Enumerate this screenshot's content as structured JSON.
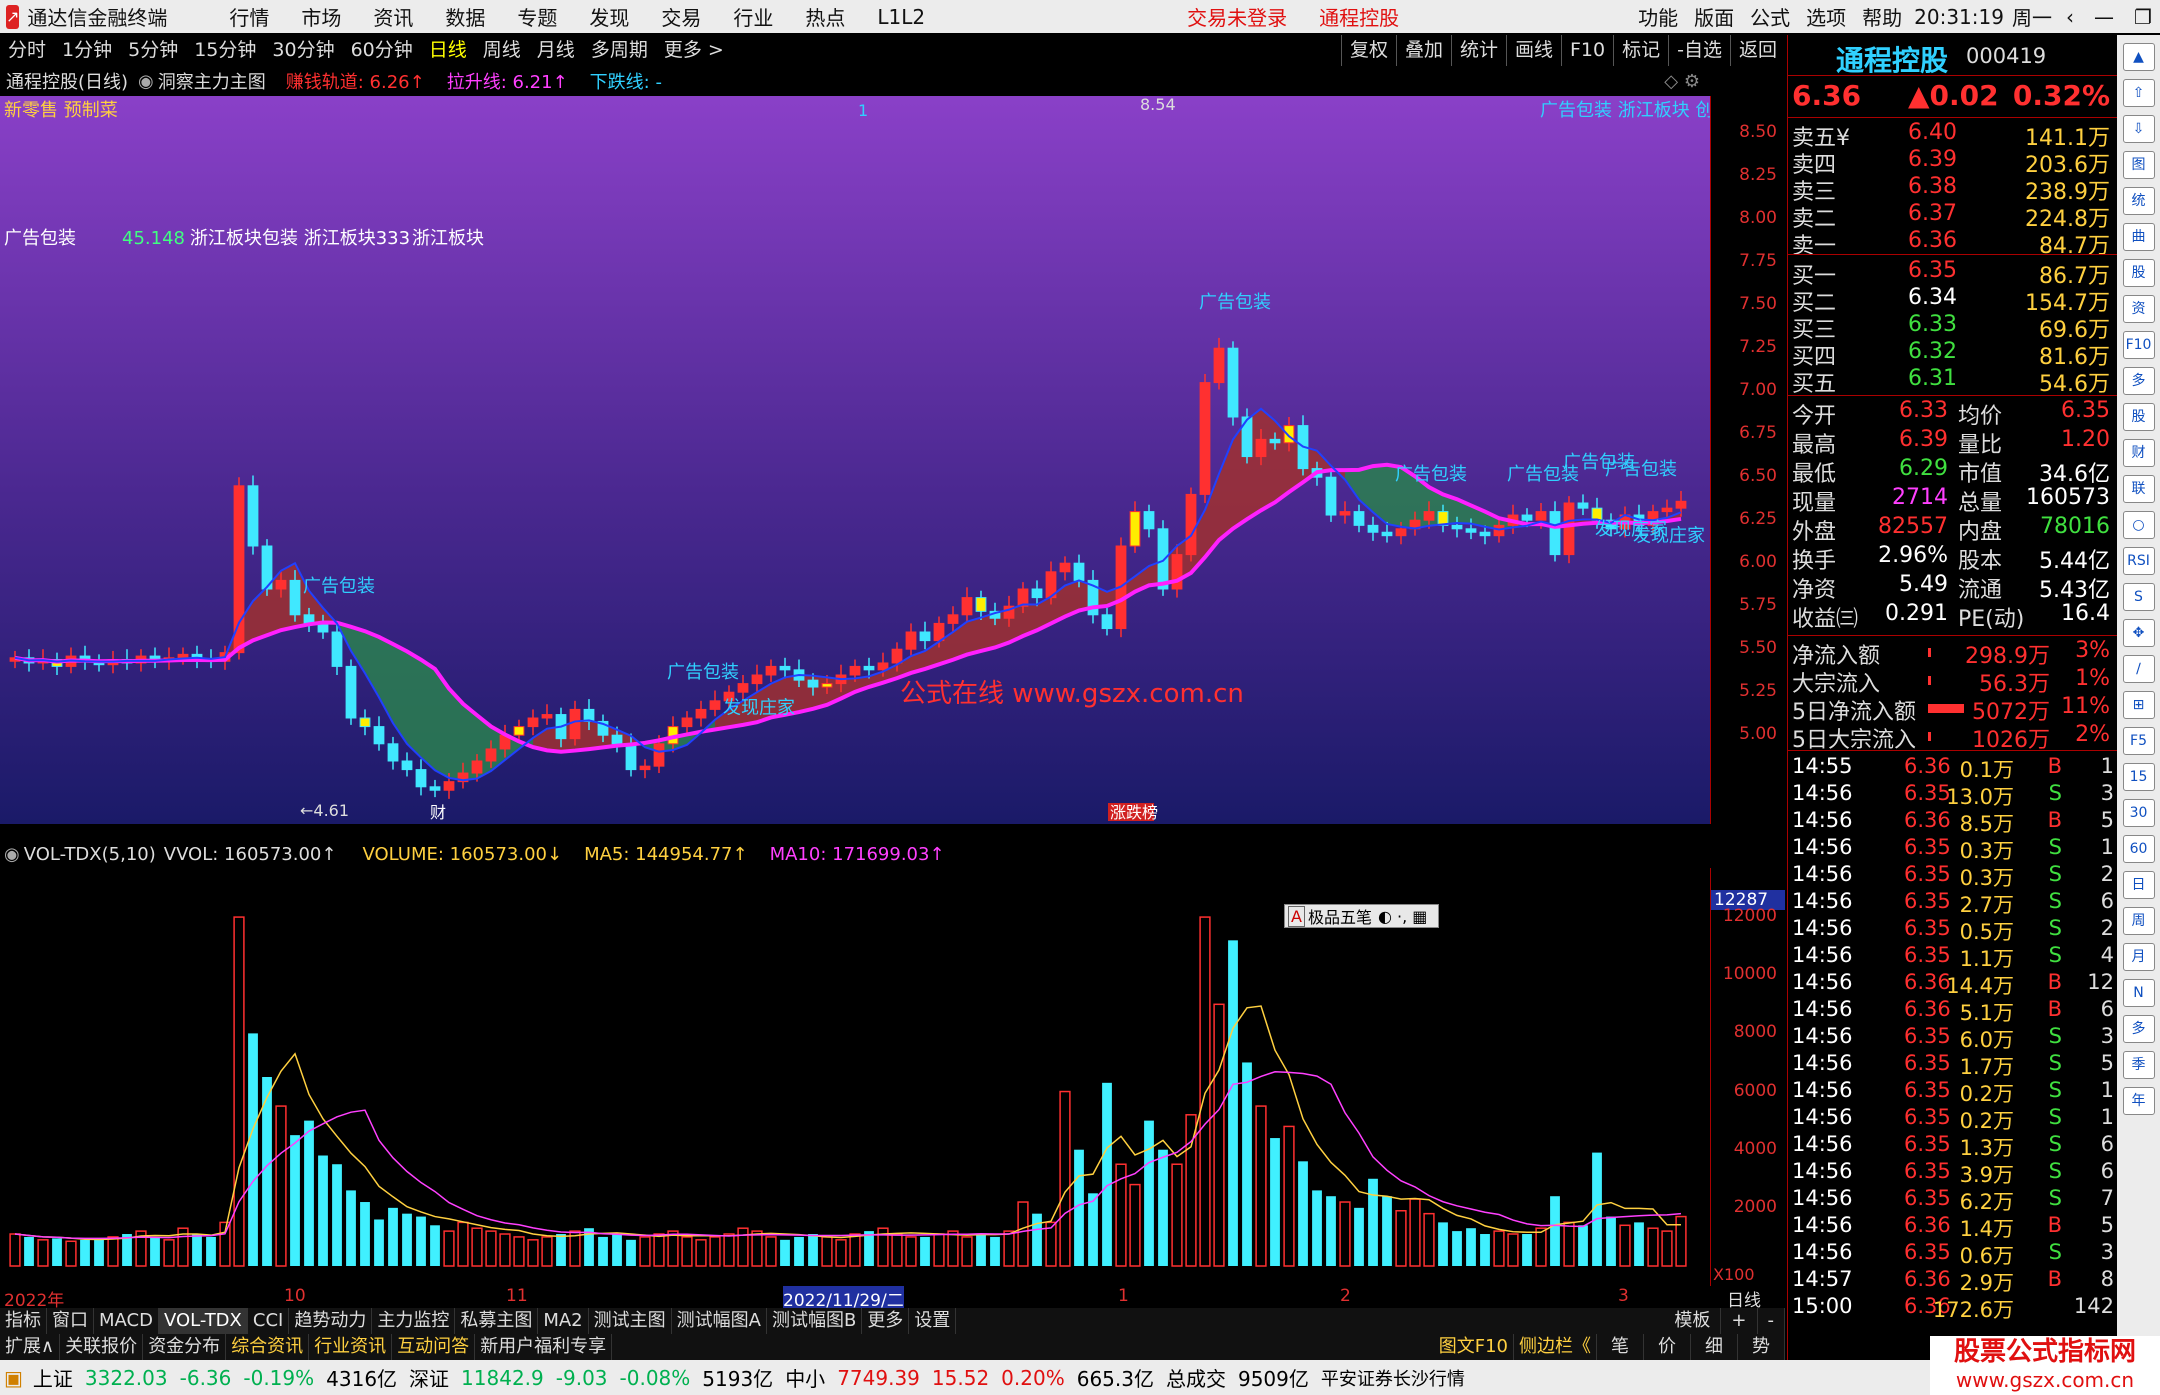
{
  "menu": {
    "app_title": "通达信金融终端",
    "items": [
      "行情",
      "市场",
      "资讯",
      "数据",
      "专题",
      "发现",
      "交易",
      "行业",
      "热点",
      "L1L2"
    ],
    "login": "交易未登录",
    "stock_name_red": "通程控股",
    "right_items": [
      "功能",
      "版面",
      "公式",
      "选项",
      "帮助"
    ],
    "clock": "20:31:19",
    "weekday": "周一"
  },
  "toolbar": {
    "periods": [
      "分时",
      "1分钟",
      "5分钟",
      "15分钟",
      "30分钟",
      "60分钟",
      "日线",
      "周线",
      "月线",
      "多周期",
      "更多 >"
    ],
    "active": "日线",
    "right": [
      "复权",
      "叠加",
      "统计",
      "画线",
      "F10",
      "标记",
      "-自选",
      "返回"
    ]
  },
  "infobar": {
    "title": "通程控股(日线)",
    "indicator": "洞察主力主图",
    "l1": "赚钱轨道: 6.26↑",
    "l2": "拉升线: 6.21↑",
    "l3": "下跌线: -"
  },
  "chart_overlay": {
    "top_left": "新零售 预制菜",
    "top_mid": "1",
    "top_right": "广告包装 浙江板块 创",
    "row2_a": "广告包装",
    "row2_b": "45.148",
    "row2_c": "浙江板块包装 浙江板块333",
    "row2_d": "浙江板块",
    "high_label": "8.54",
    "low_label": "←4.61",
    "watermark": "公式在线  www.gszx.com.cn",
    "sig_labels": [
      "广告包装",
      "广告包装",
      "广告包装",
      "广告包装",
      "广告包装",
      "广告包装",
      "广告包装"
    ],
    "find_labels": [
      "发现庄家",
      "发现庄家",
      "发现庄家"
    ],
    "cai": "财",
    "zdb": "涨跌榜"
  },
  "price_axis": [
    "8.50",
    "8.25",
    "8.00",
    "7.75",
    "7.50",
    "7.25",
    "7.00",
    "6.75",
    "6.50",
    "6.25",
    "6.00",
    "5.75",
    "5.50",
    "5.25",
    "5.00"
  ],
  "volbar": {
    "name": "VOL-TDX(5,10)",
    "vvol": "VVOL: 160573.00↑",
    "volume": "VOLUME: 160573.00↓",
    "ma5": "MA5: 144954.77↑",
    "ma10": "MA10: 171699.03↑"
  },
  "vol_axis": [
    "12000",
    "10000",
    "8000",
    "6000",
    "4000",
    "2000"
  ],
  "vol_axis_highlight": "12287",
  "vol_unit": "X100",
  "popup": "极品五笔",
  "dates": [
    "2022年",
    "10",
    "11",
    "2022/11/29/二",
    "1",
    "2",
    "3"
  ],
  "date_axis_right": "日线",
  "tabs1": [
    "指标",
    "窗口",
    "MACD",
    "VOL-TDX",
    "CCI",
    "趋势动力",
    "主力监控",
    "私募主图",
    "MA2",
    "测试主图",
    "测试幅图A",
    "测试幅图B",
    "更多",
    "设置"
  ],
  "tabs1_right": [
    "模板",
    "+",
    "-"
  ],
  "tabs2": [
    "扩展∧",
    "关联报价",
    "资金分布",
    "综合资讯",
    "行业资讯",
    "互动问答",
    "新用户福利专享"
  ],
  "tabs2_right": [
    "图文F10",
    "侧边栏《",
    "笔",
    "价",
    "细",
    "势"
  ],
  "quote": {
    "name": "通程控股",
    "code": "000419",
    "price": "6.36",
    "change": "▲0.02",
    "pct": "0.32%",
    "asks": [
      [
        "卖五¥",
        "6.40",
        "141.1万"
      ],
      [
        "卖四",
        "6.39",
        "203.6万"
      ],
      [
        "卖三",
        "6.38",
        "238.9万"
      ],
      [
        "卖二",
        "6.37",
        "224.8万"
      ],
      [
        "卖一",
        "6.36",
        "84.7万"
      ]
    ],
    "bids": [
      [
        "买一",
        "6.35",
        "86.7万"
      ],
      [
        "买二",
        "6.34",
        "154.7万"
      ],
      [
        "买三",
        "6.33",
        "69.6万"
      ],
      [
        "买四",
        "6.32",
        "81.6万"
      ],
      [
        "买五",
        "6.31",
        "54.6万"
      ]
    ],
    "stats": [
      [
        "今开",
        "6.33",
        "均价",
        "6.35"
      ],
      [
        "最高",
        "6.39",
        "量比",
        "1.20"
      ],
      [
        "最低",
        "6.29",
        "市值",
        "34.6亿"
      ],
      [
        "现量",
        "2714",
        "总量",
        "160573"
      ],
      [
        "外盘",
        "82557",
        "内盘",
        "78016"
      ],
      [
        "换手",
        "2.96%",
        "股本",
        "5.44亿"
      ],
      [
        "净资",
        "5.49",
        "流通",
        "5.43亿"
      ],
      [
        "收益㈢",
        "0.291",
        "PE(动)",
        "16.4"
      ]
    ],
    "flows": [
      [
        "净流入额",
        "298.9万",
        "3%"
      ],
      [
        "大宗流入",
        "56.3万",
        "1%"
      ],
      [
        "5日净流入额",
        "5072万",
        "11%"
      ],
      [
        "5日大宗流入",
        "1026万",
        "2%"
      ]
    ],
    "ticks": [
      [
        "14:55",
        "6.36",
        "0.1万",
        "B",
        "1"
      ],
      [
        "14:56",
        "6.35",
        "13.0万",
        "S",
        "3"
      ],
      [
        "14:56",
        "6.36",
        "8.5万",
        "B",
        "5"
      ],
      [
        "14:56",
        "6.35",
        "0.3万",
        "S",
        "1"
      ],
      [
        "14:56",
        "6.35",
        "0.3万",
        "S",
        "2"
      ],
      [
        "14:56",
        "6.35",
        "2.7万",
        "S",
        "6"
      ],
      [
        "14:56",
        "6.35",
        "0.5万",
        "S",
        "2"
      ],
      [
        "14:56",
        "6.35",
        "1.1万",
        "S",
        "4"
      ],
      [
        "14:56",
        "6.36",
        "14.4万",
        "B",
        "12"
      ],
      [
        "14:56",
        "6.36",
        "5.1万",
        "B",
        "6"
      ],
      [
        "14:56",
        "6.35",
        "6.0万",
        "S",
        "3"
      ],
      [
        "14:56",
        "6.35",
        "1.7万",
        "S",
        "5"
      ],
      [
        "14:56",
        "6.35",
        "0.2万",
        "S",
        "1"
      ],
      [
        "14:56",
        "6.35",
        "0.2万",
        "S",
        "1"
      ],
      [
        "14:56",
        "6.35",
        "1.3万",
        "S",
        "6"
      ],
      [
        "14:56",
        "6.35",
        "3.9万",
        "S",
        "6"
      ],
      [
        "14:56",
        "6.35",
        "6.2万",
        "S",
        "7"
      ],
      [
        "14:56",
        "6.36",
        "1.4万",
        "B",
        "5"
      ],
      [
        "14:56",
        "6.35",
        "0.6万",
        "S",
        "3"
      ],
      [
        "14:57",
        "6.36",
        "2.9万",
        "B",
        "8"
      ],
      [
        "15:00",
        "6.36",
        "172.6万",
        "",
        "142"
      ]
    ]
  },
  "rail": [
    "▲",
    "⇧",
    "⇩",
    "图",
    "统",
    "曲",
    "股",
    "资",
    "F10",
    "多",
    "股",
    "财",
    "联",
    "○",
    "RSI",
    "S",
    "✥",
    "∕",
    "⊞",
    "F5",
    "15",
    "30",
    "60",
    "日",
    "周",
    "月",
    "N",
    "多",
    "季",
    "年"
  ],
  "status": {
    "sh_label": "上证",
    "sh": "3322.03",
    "sh_chg": "-6.36",
    "sh_pct": "-0.19%",
    "sh_amt": "4316亿",
    "sz_label": "深证",
    "sz": "11842.9",
    "sz_chg": "-9.03",
    "sz_pct": "-0.08%",
    "sz_amt": "5193亿",
    "zx_label": "中小",
    "zx": "7749.39",
    "zx_chg": "15.52",
    "zx_pct": "0.20%",
    "zx_amt": "665.3亿",
    "total_label": "总成交",
    "total": "9509亿",
    "broker": "平安证券长沙行情",
    "watermark_title": "股票公式指标网",
    "watermark_url": "www.gszx.com.cn"
  },
  "chart_data": {
    "type": "candlestick",
    "y_range": [
      4.6,
      8.6
    ],
    "closes": [
      5.45,
      5.42,
      5.44,
      5.4,
      5.46,
      5.43,
      5.41,
      5.44,
      5.42,
      5.46,
      5.43,
      5.45,
      5.47,
      5.44,
      5.43,
      5.48,
      6.45,
      6.1,
      5.85,
      5.9,
      5.7,
      5.65,
      5.6,
      5.4,
      5.1,
      5.05,
      4.95,
      4.85,
      4.8,
      4.7,
      4.68,
      4.73,
      4.78,
      4.85,
      4.92,
      5.0,
      5.05,
      5.1,
      5.12,
      4.98,
      5.15,
      5.08,
      5.0,
      4.95,
      4.8,
      4.82,
      4.95,
      5.05,
      5.1,
      5.15,
      5.2,
      5.25,
      5.3,
      5.35,
      5.4,
      5.38,
      5.32,
      5.28,
      5.3,
      5.35,
      5.4,
      5.38,
      5.42,
      5.5,
      5.6,
      5.55,
      5.65,
      5.7,
      5.8,
      5.72,
      5.68,
      5.75,
      5.85,
      5.8,
      5.95,
      6.0,
      5.9,
      5.7,
      5.62,
      6.1,
      6.3,
      6.2,
      5.85,
      6.05,
      6.4,
      7.05,
      7.25,
      6.85,
      6.62,
      6.72,
      6.7,
      6.8,
      6.55,
      6.5,
      6.28,
      6.3,
      6.22,
      6.18,
      6.16,
      6.2,
      6.25,
      6.3,
      6.22,
      6.2,
      6.18,
      6.16,
      6.22,
      6.28,
      6.25,
      6.3,
      6.05,
      6.35,
      6.32,
      6.25,
      6.2,
      6.28,
      6.22,
      6.3,
      6.32,
      6.36
    ],
    "volumes": [
      1100,
      1000,
      900,
      950,
      850,
      900,
      950,
      1000,
      1100,
      1200,
      1000,
      900,
      1300,
      1100,
      1000,
      1500,
      12000,
      8000,
      6500,
      5500,
      4500,
      5000,
      3800,
      3500,
      2600,
      2200,
      1600,
      2000,
      1800,
      1700,
      1400,
      1200,
      1500,
      1300,
      1200,
      1100,
      1000,
      900,
      1000,
      1100,
      1200,
      1300,
      1000,
      1100,
      900,
      1000,
      1100,
      1200,
      1000,
      900,
      1000,
      1100,
      1300,
      1200,
      1000,
      900,
      1000,
      1100,
      1000,
      900,
      1100,
      1200,
      1300,
      1100,
      1000,
      1000,
      1100,
      1200,
      1000,
      1100,
      1000,
      1200,
      2200,
      1800,
      1500,
      6000,
      4000,
      2500,
      6300,
      3500,
      2800,
      5000,
      4000,
      3500,
      5200,
      12000,
      9000,
      11200,
      7000,
      5500,
      4400,
      4800,
      3600,
      2600,
      2400,
      2200,
      2000,
      3000,
      2400,
      1900,
      2300,
      1800,
      1500,
      1200,
      1300,
      1100,
      1200,
      1100,
      1100,
      1300,
      2400,
      1500,
      1400,
      3900,
      1700,
      1400,
      1500,
      1300,
      1200,
      1700
    ]
  }
}
